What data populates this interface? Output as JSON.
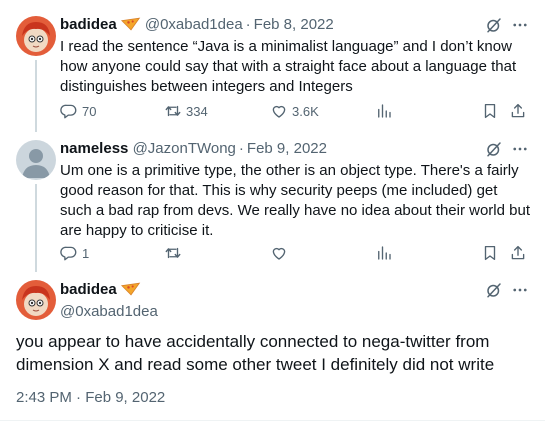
{
  "colors": {
    "text": "#0f1419",
    "secondary": "#536471",
    "thread_line": "#cfd9de",
    "badge": "#f4a62a"
  },
  "tweets": [
    {
      "name": "badidea",
      "handle": "@0xabad1dea",
      "separator": "·",
      "date": "Feb 8, 2022",
      "text": "I read the sentence “Java is a minimalist language” and I don’t know how anyone could say that with a straight face about a language that distinguishes between integers and Integers",
      "avatar_icon": "avatar-red-hair-icon",
      "badge_icon": "pizza-slice-icon",
      "stats": {
        "replies": "70",
        "retweets": "334",
        "likes": "3.6K"
      }
    },
    {
      "name": "nameless",
      "handle": "@JazonTWong",
      "separator": "·",
      "date": "Feb 9, 2022",
      "text": "Um one is a primitive type, the other is an object type. There's a fairly good reason for that. This is why security peeps (me included) get such a bad rap from devs. We really have no idea about their world but are happy to criticise it.",
      "avatar_icon": "default-avatar-icon",
      "stats": {
        "replies": "1",
        "retweets": "",
        "likes": ""
      }
    }
  ],
  "main_tweet": {
    "name": "badidea",
    "handle": "@0xabad1dea",
    "text": "you appear to have accidentally connected to nega-twitter from dimension X and read some other tweet I definitely did not write",
    "timestamp": "2:43 PM · Feb 9, 2022",
    "avatar_icon": "avatar-red-hair-icon",
    "badge_icon": "pizza-slice-icon"
  }
}
